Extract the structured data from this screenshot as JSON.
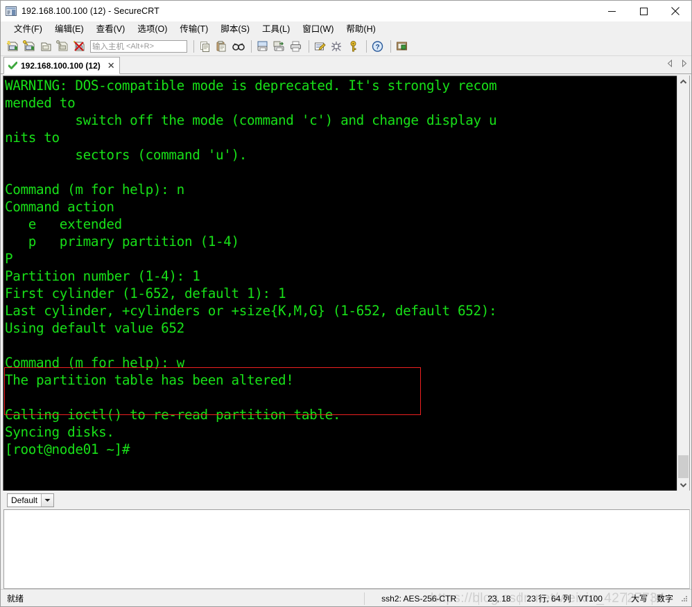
{
  "window": {
    "title": "192.168.100.100 (12) - SecureCRT",
    "icon": "securecrt-app-icon",
    "minimize_label": "—",
    "maximize_label": "☐",
    "close_label": "✕"
  },
  "menubar": {
    "items": [
      {
        "label": "文件(F)",
        "name": "menu-file"
      },
      {
        "label": "编辑(E)",
        "name": "menu-edit"
      },
      {
        "label": "查看(V)",
        "name": "menu-view"
      },
      {
        "label": "选项(O)",
        "name": "menu-options"
      },
      {
        "label": "传输(T)",
        "name": "menu-transfer"
      },
      {
        "label": "脚本(S)",
        "name": "menu-script"
      },
      {
        "label": "工具(L)",
        "name": "menu-tools"
      },
      {
        "label": "窗口(W)",
        "name": "menu-window"
      },
      {
        "label": "帮助(H)",
        "name": "menu-help"
      }
    ]
  },
  "toolbar": {
    "icons_left": [
      "new-session-icon",
      "connect-session-icon",
      "clone-session-icon",
      "connect-sftp-icon",
      "disconnect-icon"
    ],
    "host_input": {
      "placeholder": "输入主机",
      "hotkey": "<Alt+R>",
      "value": ""
    },
    "icons_right_group1": [
      "copy-icon",
      "paste-icon",
      "find-icon"
    ],
    "icons_right_group2": [
      "print-screen-icon",
      "print-selection-icon",
      "print-icon"
    ],
    "icons_right_group3": [
      "session-options-icon",
      "global-options-icon",
      "key-icon"
    ],
    "icons_right_group4": [
      "help-icon"
    ],
    "icons_right_group5": [
      "session-manager-icon"
    ]
  },
  "tabbar": {
    "tabs": [
      {
        "label": "192.168.100.100 (12)",
        "status_icon": "connected-check-icon",
        "close_icon": "close-icon",
        "active": true
      }
    ],
    "scroll_left_icon": "triangle-left-icon",
    "scroll_right_icon": "triangle-right-icon"
  },
  "terminal": {
    "foreground_color": "#18e018",
    "background_color": "#000000",
    "highlight_color": "#f02020",
    "lines": [
      "WARNING: DOS-compatible mode is deprecated. It's strongly recom",
      "mended to",
      "         switch off the mode (command 'c') and change display u",
      "nits to",
      "         sectors (command 'u').",
      "",
      "Command (m for help): n",
      "Command action",
      "   e   extended",
      "   p   primary partition (1-4)",
      "P",
      "Partition number (1-4): 1",
      "First cylinder (1-652, default 1): 1",
      "Last cylinder, +cylinders or +size{K,M,G} (1-652, default 652):",
      "Using default value 652",
      "",
      "Command (m for help): w",
      "The partition table has been altered!",
      "",
      "Calling ioctl() to re-read partition table.",
      "Syncing disks.",
      "[root@node01 ~]#"
    ],
    "highlight_start_line": 16,
    "highlight_end_line": 17,
    "scrollbar": {
      "up_icon": "chevron-up-icon",
      "down_icon": "chevron-down-icon"
    }
  },
  "session_strip": {
    "combo_value": "Default",
    "combo_arrow_icon": "chevron-down-icon"
  },
  "statusbar": {
    "ready_text": "就绪",
    "encryption": "ssh2: AES-256-CTR",
    "cursor_position": "23, 18",
    "dimensions": "23 行, 64 列",
    "emulation": "VT100",
    "caps_lock": "大写",
    "num_lock": "数字",
    "grip_icon": "resize-grip-icon"
  },
  "watermark": {
    "text": "https://blog.csdn.net/weixin_42727734"
  }
}
